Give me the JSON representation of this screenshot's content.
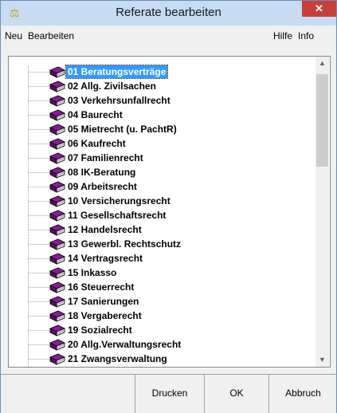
{
  "window": {
    "title": "Referate bearbeiten",
    "close_label": "✕",
    "app_icon": "scales-icon"
  },
  "menu": {
    "left": [
      "Neu",
      "Bearbeiten"
    ],
    "right": [
      "Hilfe",
      "Info"
    ]
  },
  "tree": {
    "item_icon": "book-icon",
    "selected_index": 0,
    "items": [
      "01 Beratungsverträge",
      "02 Allg. Zivilsachen",
      "03 Verkehrsunfallrecht",
      "04 Baurecht",
      "05 Mietrecht (u. PachtR)",
      "06 Kaufrecht",
      "07 Familienrecht",
      "08 IK-Beratung",
      "09 Arbeitsrecht",
      "10 Versicherungsrecht",
      "11 Gesellschaftsrecht",
      "12 Handelsrecht",
      "13 Gewerbl. Rechtschutz",
      "14 Vertragsrecht",
      "15 Inkasso",
      "16 Steuerrecht",
      "17 Sanierungen",
      "18 Vergaberecht",
      "19 Sozialrecht",
      "20 Allg.Verwaltungsrecht",
      "21 Zwangsverwaltung"
    ]
  },
  "buttons": {
    "print": "Drucken",
    "ok": "OK",
    "cancel": "Abbruch"
  },
  "colors": {
    "book": "#8b1a9a",
    "selection": "#3399ff",
    "titlebar": "#c7dbf2",
    "close": "#c7403a"
  }
}
